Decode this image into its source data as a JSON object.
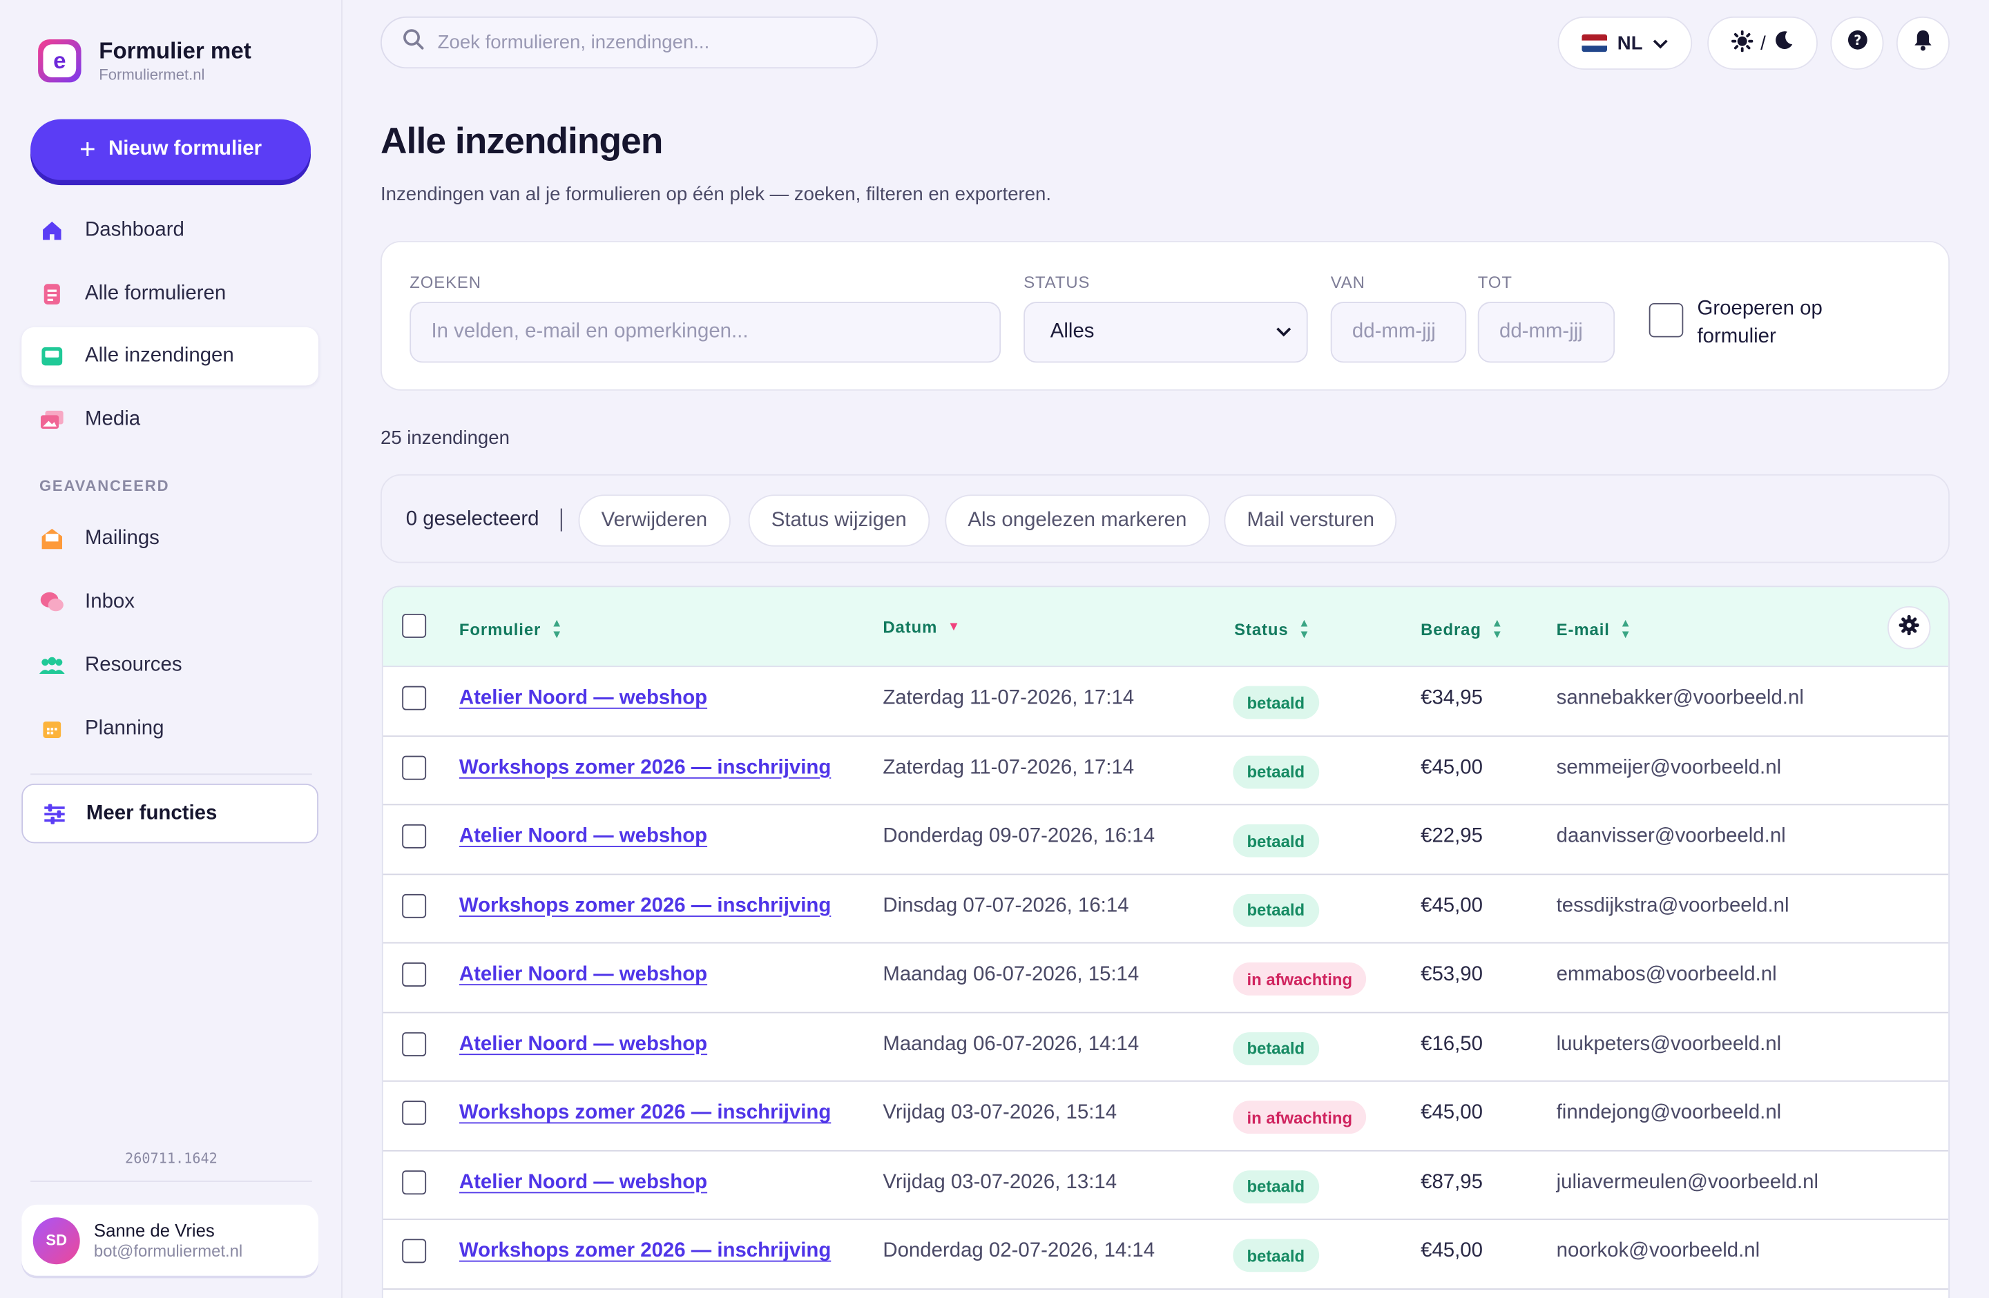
{
  "brand": {
    "title": "Formulier met",
    "subtitle": "Formuliermet.nl",
    "logo_letter": "e"
  },
  "sidebar": {
    "new_button": "Nieuw formulier",
    "items": [
      {
        "label": "Dashboard",
        "icon": "home-icon",
        "color": "#5b3df5"
      },
      {
        "label": "Alle formulieren",
        "icon": "form-icon",
        "color": "#f06595"
      },
      {
        "label": "Alle inzendingen",
        "icon": "inbox-tray-icon",
        "color": "#20c997"
      },
      {
        "label": "Media",
        "icon": "image-icon",
        "color": "#f06595"
      }
    ],
    "section_label": "GEAVANCEERD",
    "advanced_items": [
      {
        "label": "Mailings",
        "icon": "mail-icon",
        "color": "#fd9a3a"
      },
      {
        "label": "Inbox",
        "icon": "chat-icon",
        "color": "#f06595"
      },
      {
        "label": "Resources",
        "icon": "users-icon",
        "color": "#20c997"
      },
      {
        "label": "Planning",
        "icon": "calendar-icon",
        "color": "#fcb33a"
      }
    ],
    "more_button": "Meer functies",
    "version": "260711.1642",
    "user": {
      "initials": "SD",
      "name": "Sanne de Vries",
      "email": "bot@formuliermet.nl"
    }
  },
  "topbar": {
    "search_placeholder": "Zoek formulieren, inzendingen...",
    "language": "NL",
    "theme_separator": "/"
  },
  "page": {
    "title": "Alle inzendingen",
    "subtitle": "Inzendingen van al je formulieren op één plek — zoeken, filteren en exporteren."
  },
  "filters": {
    "search_label": "ZOEKEN",
    "search_placeholder": "In velden, e-mail en opmerkingen...",
    "status_label": "STATUS",
    "status_value": "Alles",
    "from_label": "VAN",
    "from_placeholder": "dd-mm-jjj",
    "to_label": "TOT",
    "to_placeholder": "dd-mm-jjj",
    "group_label": "Groeperen op formulier"
  },
  "count_text": "25 inzendingen",
  "bulk": {
    "selected": "0 geselecteerd",
    "actions": [
      "Verwijderen",
      "Status wijzigen",
      "Als ongelezen markeren",
      "Mail versturen"
    ]
  },
  "table": {
    "headers": {
      "form": "Formulier",
      "date": "Datum",
      "status": "Status",
      "amount": "Bedrag",
      "email": "E-mail"
    },
    "rows": [
      {
        "form": "Atelier Noord — webshop",
        "date": "Zaterdag 11-07-2026, 17:14",
        "status": "betaald",
        "amount": "€34,95",
        "email": "sannebakker@voorbeeld.nl"
      },
      {
        "form": "Workshops zomer 2026 — inschrijving",
        "date": "Zaterdag 11-07-2026, 17:14",
        "status": "betaald",
        "amount": "€45,00",
        "email": "semmeijer@voorbeeld.nl"
      },
      {
        "form": "Atelier Noord — webshop",
        "date": "Donderdag 09-07-2026, 16:14",
        "status": "betaald",
        "amount": "€22,95",
        "email": "daanvisser@voorbeeld.nl"
      },
      {
        "form": "Workshops zomer 2026 — inschrijving",
        "date": "Dinsdag 07-07-2026, 16:14",
        "status": "betaald",
        "amount": "€45,00",
        "email": "tessdijkstra@voorbeeld.nl"
      },
      {
        "form": "Atelier Noord — webshop",
        "date": "Maandag 06-07-2026, 15:14",
        "status": "in afwachting",
        "amount": "€53,90",
        "email": "emmabos@voorbeeld.nl"
      },
      {
        "form": "Atelier Noord — webshop",
        "date": "Maandag 06-07-2026, 14:14",
        "status": "betaald",
        "amount": "€16,50",
        "email": "luukpeters@voorbeeld.nl"
      },
      {
        "form": "Workshops zomer 2026 — inschrijving",
        "date": "Vrijdag 03-07-2026, 15:14",
        "status": "in afwachting",
        "amount": "€45,00",
        "email": "finndejong@voorbeeld.nl"
      },
      {
        "form": "Atelier Noord — webshop",
        "date": "Vrijdag 03-07-2026, 13:14",
        "status": "betaald",
        "amount": "€87,95",
        "email": "juliavermeulen@voorbeeld.nl"
      },
      {
        "form": "Workshops zomer 2026 — inschrijving",
        "date": "Donderdag 02-07-2026, 14:14",
        "status": "betaald",
        "amount": "€45,00",
        "email": "noorkok@voorbeeld.nl"
      }
    ]
  },
  "colors": {
    "accent": "#5b3df5",
    "paid": "#158a62",
    "pending": "#d0245f",
    "header_bg": "#e7fbf4"
  }
}
